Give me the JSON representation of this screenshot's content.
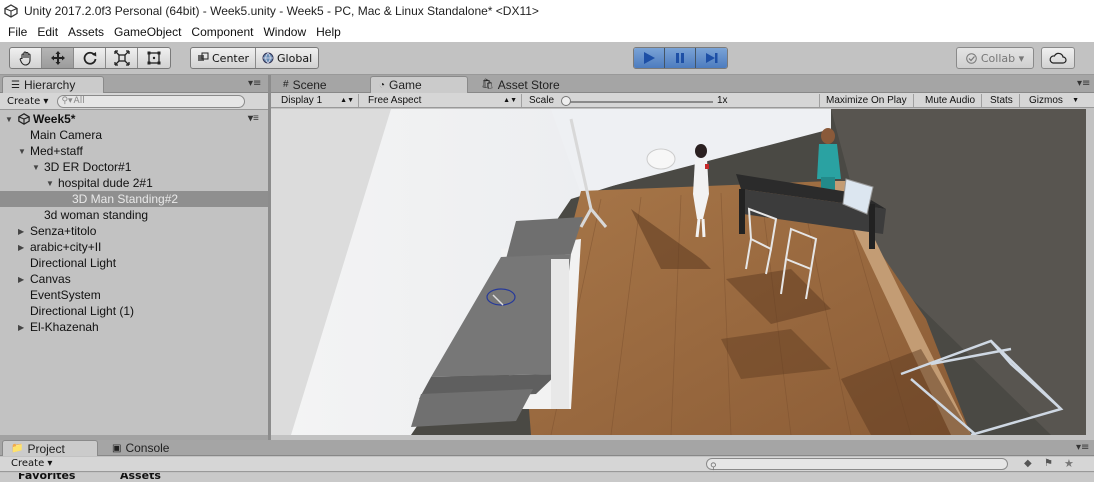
{
  "window": {
    "title": "Unity 2017.2.0f3 Personal (64bit) - Week5.unity - Week5 - PC, Mac & Linux Standalone* <DX11>"
  },
  "menu": [
    "File",
    "Edit",
    "Assets",
    "GameObject",
    "Component",
    "Window",
    "Help"
  ],
  "toolbar": {
    "tools": [
      "hand-tool",
      "move-tool",
      "rotate-tool",
      "scale-tool",
      "rect-tool"
    ],
    "active_tool": "move-tool",
    "pivot": "Center",
    "space": "Global",
    "collab_label": "Collab ▾"
  },
  "hierarchy": {
    "tab": "Hierarchy",
    "create_label": "Create ▾",
    "search_placeholder": "All",
    "scene": "Week5*",
    "items": [
      {
        "label": "Main Camera",
        "depth": 1,
        "arrow": ""
      },
      {
        "label": "Med+staff",
        "depth": 1,
        "arrow": "▼"
      },
      {
        "label": "3D ER Doctor#1",
        "depth": 2,
        "arrow": "▼"
      },
      {
        "label": "hospital dude 2#1",
        "depth": 3,
        "arrow": "▼"
      },
      {
        "label": "3D Man Standing#2",
        "depth": 4,
        "arrow": "",
        "selected": true
      },
      {
        "label": "3d woman standing",
        "depth": 2,
        "arrow": ""
      },
      {
        "label": "Senza+titolo",
        "depth": 1,
        "arrow": "▶"
      },
      {
        "label": "arabic+city+II",
        "depth": 1,
        "arrow": "▶"
      },
      {
        "label": "Directional Light",
        "depth": 1,
        "arrow": ""
      },
      {
        "label": "Canvas",
        "depth": 1,
        "arrow": "▶"
      },
      {
        "label": "EventSystem",
        "depth": 1,
        "arrow": ""
      },
      {
        "label": "Directional Light (1)",
        "depth": 1,
        "arrow": ""
      },
      {
        "label": "El-Khazenah",
        "depth": 1,
        "arrow": "▶"
      }
    ]
  },
  "center_tabs": {
    "scene": "Scene",
    "game": "Game",
    "asset_store": "Asset Store"
  },
  "game_toolbar": {
    "display": "Display 1",
    "aspect": "Free Aspect",
    "scale_label": "Scale",
    "scale_value": "1x",
    "maximize": "Maximize On Play",
    "mute": "Mute Audio",
    "stats": "Stats",
    "gizmos": "Gizmos"
  },
  "bottom": {
    "project_tab": "Project",
    "console_tab": "Console",
    "create_label": "Create ▾",
    "favorites": "Favorites",
    "assets": "Assets"
  },
  "colors": {
    "play_accent": "#4d7cbf",
    "selected_row": "#8f8f8f",
    "floor": "#9a6a42"
  }
}
